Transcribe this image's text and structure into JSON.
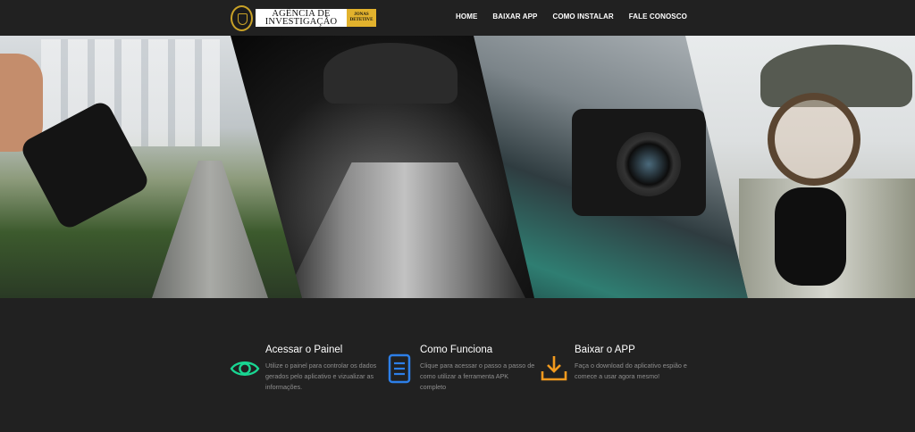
{
  "logo": {
    "line1": "AGÊNCIA DE",
    "line2": "INVESTIGAÇÃO",
    "badge_line1": "JONAS",
    "badge_line2": "DETETIVE"
  },
  "nav": {
    "items": [
      {
        "label": "HOME"
      },
      {
        "label": "BAIXAR APP"
      },
      {
        "label": "COMO INSTALAR"
      },
      {
        "label": "FALE CONOSCO"
      }
    ]
  },
  "features": [
    {
      "title": "Acessar o Painel",
      "text": "Utilize o painel para controlar os dados gerados pelo aplicativo e vizualizar as informações.",
      "icon": "eye-icon",
      "color": "#19d692"
    },
    {
      "title": "Como Funciona",
      "text": "Clique para acessar o passo a passo de como utilizar a ferramenta APK completo",
      "icon": "document-icon",
      "color": "#2d7fe8"
    },
    {
      "title": "Baixar o APP",
      "text": "Faça o download do aplicativo espião e comece a usar agora mesmo!",
      "icon": "download-icon",
      "color": "#f29a1e"
    }
  ]
}
